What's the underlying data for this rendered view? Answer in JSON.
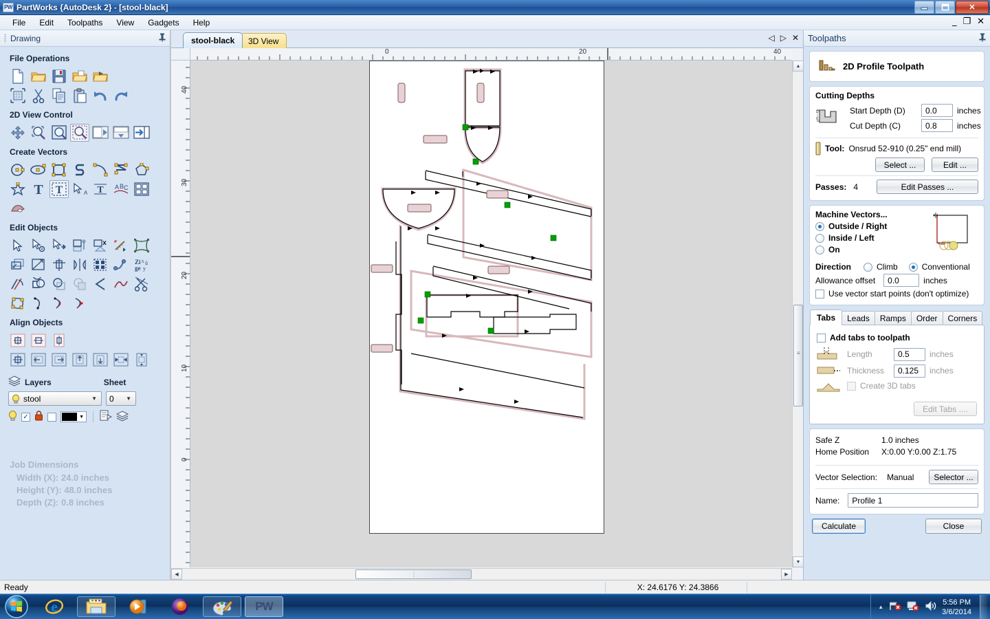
{
  "window": {
    "title": "PartWorks {AutoDesk 2} - [stool-black]",
    "app_icon": "partworks-icon",
    "minimize": "–",
    "maximize": "❐",
    "close": "✕",
    "mdi_minimize": "_",
    "mdi_restore": "❐",
    "mdi_close": "✕"
  },
  "menubar": {
    "items": [
      "File",
      "Edit",
      "Toolpaths",
      "View",
      "Gadgets",
      "Help"
    ]
  },
  "drawing_panel": {
    "header": "Drawing",
    "pin": "pin-icon",
    "sections": [
      {
        "title": "File Operations",
        "rows": [
          [
            "new-file-icon",
            "open-folder-icon",
            "save-icon",
            "open-recent-icon",
            "import-icon"
          ],
          [
            "job-setup-icon",
            "cut-icon",
            "copy-icon",
            "paste-icon",
            "undo-icon",
            "redo-icon"
          ]
        ]
      },
      {
        "title": "2D View Control",
        "rows": [
          [
            "pan-icon",
            "zoom-window-icon",
            "zoom-extents-icon",
            "zoom-selected-icon",
            "toggle-left-view-icon",
            "toggle-split-view-icon",
            "swap-panes-icon"
          ]
        ]
      },
      {
        "title": "Create Vectors",
        "rows": [
          [
            "circle-icon",
            "ellipse-icon",
            "rectangle-icon",
            "polyline-icon",
            "arc-icon",
            "curve-icon",
            "polygon-icon"
          ],
          [
            "star-icon",
            "text-icon",
            "text-block-icon",
            "text-select-icon",
            "text-on-curve-icon",
            "arc-text-icon",
            "array-copy-icon"
          ],
          [
            "trace-bitmap-icon"
          ]
        ]
      },
      {
        "title": "Edit Objects",
        "rows": [
          [
            "select-icon",
            "node-edit-icon",
            "move-icon",
            "set-size-icon",
            "delete-icon",
            "measure-icon",
            "distort-icon"
          ],
          [
            "offset-icon",
            "scale-icon",
            "mirror-icon",
            "flip-icon",
            "nest-icon",
            "join-icon",
            "zigzag-icon"
          ],
          [
            "fillet-icon",
            "weld-icon",
            "subtract-icon",
            "intersect-icon",
            "trim-icon",
            "smooth-icon",
            "scissors-icon"
          ],
          [
            "node-points-icon",
            "start-point-icon",
            "insert-point-icon",
            "remove-point-icon"
          ]
        ]
      },
      {
        "title": "Align Objects",
        "rows": [
          [
            "align-center-icon",
            "align-horizontal-center-icon",
            "align-vertical-center-icon"
          ],
          [
            "center-in-job-icon",
            "align-left-icon",
            "align-right-icon",
            "align-top-icon",
            "align-bottom-icon",
            "space-horizontal-icon",
            "space-vertical-icon"
          ]
        ]
      }
    ],
    "layers": {
      "icon": "layers-icon",
      "label": "Layers",
      "sheet_label": "Sheet",
      "selected_layer": "stool",
      "layer_bulb_icon": "lightbulb-icon",
      "selected_sheet": "0",
      "tools": {
        "visible_icon": "lightbulb-icon",
        "checked": "✓",
        "lock_icon": "lock-icon",
        "unchecked": "",
        "color": "#000000",
        "layer_props_icon": "layer-properties-icon",
        "merge_layers_icon": "merge-layers-icon"
      }
    },
    "job_dimensions": {
      "title": "Job Dimensions",
      "width": "Width  (X): 24.0 inches",
      "height": "Height (Y): 48.0 inches",
      "depth": "Depth  (Z): 0.8 inches"
    }
  },
  "center": {
    "tabs": [
      {
        "label": "stool-black",
        "active": true
      },
      {
        "label": "3D View",
        "active": false
      }
    ],
    "nav": {
      "prev": "◁",
      "next": "▷",
      "close": "✕"
    },
    "ruler_h": {
      "labels": [
        "0",
        "20",
        "40"
      ],
      "unit": "inches"
    },
    "ruler_v": {
      "labels": [
        "40",
        "30",
        "20",
        "10",
        "0"
      ],
      "unit": "inches"
    },
    "toolpath_colors": {
      "vector": "#000000",
      "offset": "#d8b8bc",
      "start_point": "#00a000"
    }
  },
  "toolpaths_panel": {
    "header": "Toolpaths",
    "pin": "pin-icon",
    "toolpath_type": {
      "icon": "profile-toolpath-icon",
      "name": "2D Profile Toolpath"
    },
    "cutting_depths": {
      "label": "Cutting Depths",
      "diagram_icon": "cut-depth-diagram-icon",
      "start_depth_label": "Start Depth (D)",
      "start_depth_value": "0.0",
      "start_depth_unit": "inches",
      "cut_depth_label": "Cut Depth (C)",
      "cut_depth_value": "0.8",
      "cut_depth_unit": "inches"
    },
    "tool": {
      "icon": "end-mill-icon",
      "label": "Tool:",
      "value": "Onsrud 52-910 (0.25\" end mill)",
      "select_button": "Select ...",
      "edit_button": "Edit ..."
    },
    "passes": {
      "label": "Passes:",
      "value": "4",
      "edit_button": "Edit Passes ..."
    },
    "machine_vectors": {
      "label": "Machine Vectors...",
      "options": [
        {
          "label": "Outside / Right",
          "selected": true
        },
        {
          "label": "Inside / Left",
          "selected": false
        },
        {
          "label": "On",
          "selected": false
        }
      ],
      "direction_label": "Direction",
      "directions": [
        {
          "label": "Climb",
          "selected": false
        },
        {
          "label": "Conventional",
          "selected": true
        }
      ],
      "preview_icon": "vector-offset-preview-icon",
      "allowance_label": "Allowance offset",
      "allowance_value": "0.0",
      "allowance_unit": "inches",
      "start_points_label": "Use vector start points (don't optimize)",
      "start_points_checked": false
    },
    "option_tabs": [
      {
        "label": "Tabs",
        "active": true
      },
      {
        "label": "Leads",
        "active": false
      },
      {
        "label": "Ramps",
        "active": false
      },
      {
        "label": "Order",
        "active": false
      },
      {
        "label": "Corners",
        "active": false
      }
    ],
    "tabs_panel": {
      "add_tabs_label": "Add tabs to toolpath",
      "add_tabs_checked": false,
      "length_icon": "tab-length-icon",
      "length_label": "Length",
      "length_value": "0.5",
      "length_unit": "inches",
      "thickness_icon": "tab-thickness-icon",
      "thickness_label": "Thickness",
      "thickness_value": "0.125",
      "thickness_unit": "inches",
      "tabs3d_icon": "tab-3d-icon",
      "tabs3d_label": "Create 3D tabs",
      "tabs3d_checked": false,
      "edit_tabs_button": "Edit Tabs ...."
    },
    "positions": {
      "safe_z_label": "Safe Z",
      "safe_z_value": "1.0 inches",
      "home_label": "Home Position",
      "home_value": "X:0.00 Y:0.00 Z:1.75"
    },
    "vector_selection": {
      "label": "Vector Selection:",
      "value": "Manual",
      "selector_button": "Selector ..."
    },
    "name": {
      "label": "Name:",
      "value": "Profile 1"
    },
    "actions": {
      "calculate": "Calculate",
      "close": "Close"
    }
  },
  "statusbar": {
    "ready": "Ready",
    "coordinates": "X: 24.6176 Y: 24.3866"
  },
  "taskbar": {
    "start_icon": "windows-start-icon",
    "items": [
      {
        "icon": "internet-explorer-icon",
        "framed": false,
        "active": false
      },
      {
        "icon": "file-explorer-icon",
        "framed": true,
        "active": false
      },
      {
        "icon": "media-player-icon",
        "framed": false,
        "active": false
      },
      {
        "icon": "firefox-icon",
        "framed": false,
        "active": false
      },
      {
        "icon": "paint-icon",
        "framed": true,
        "active": false
      },
      {
        "icon": "partworks-icon",
        "framed": true,
        "active": true,
        "label": "PW"
      }
    ],
    "tray": {
      "expand_icon": "show-hidden-icons-icon",
      "network_icon": "network-error-icon",
      "action_icon": "action-center-error-icon",
      "volume_icon": "volume-icon",
      "time": "5:56 PM",
      "date": "3/6/2014"
    }
  }
}
